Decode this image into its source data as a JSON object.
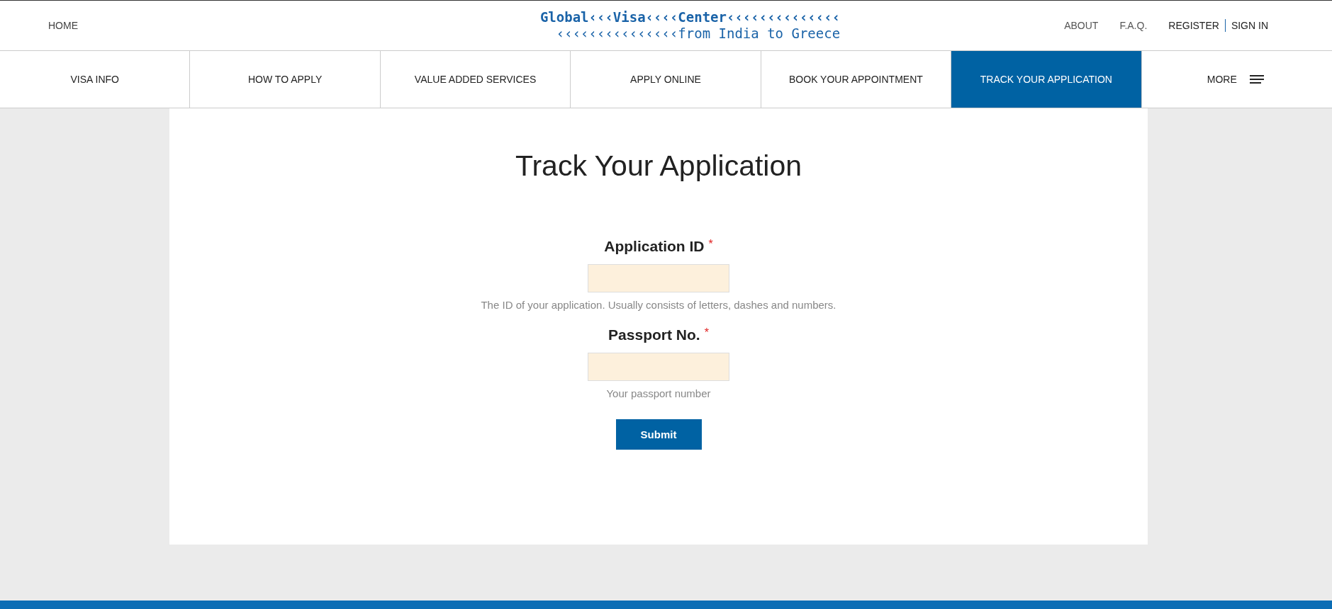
{
  "header": {
    "home": "HOME",
    "logo_line1": "Global‹‹‹Visa‹‹‹‹Center‹‹‹‹‹‹‹‹‹‹‹‹‹‹",
    "logo_line2": "‹‹‹‹‹‹‹‹‹‹‹‹‹‹‹from India to Greece",
    "links": [
      "ABOUT",
      "F.A.Q."
    ],
    "register": "REGISTER",
    "sign_in": "SIGN IN"
  },
  "nav": [
    {
      "label": "VISA INFO",
      "selected": false
    },
    {
      "label": "HOW TO APPLY",
      "selected": false
    },
    {
      "label": "VALUE ADDED SERVICES",
      "selected": false
    },
    {
      "label": "APPLY ONLINE",
      "selected": false
    },
    {
      "label": "BOOK YOUR APPOINTMENT",
      "selected": false
    },
    {
      "label": "TRACK YOUR APPLICATION",
      "selected": true
    },
    {
      "label": "MORE",
      "selected": false,
      "kind": "menu"
    }
  ],
  "page": {
    "title": "Track Your Application",
    "fields": [
      {
        "label": "Application ID",
        "required": "*",
        "hint": "The ID of your application. Usually consists of letters, dashes and numbers."
      },
      {
        "label": "Passport No.",
        "required": "*",
        "hint": "Your passport number"
      }
    ],
    "submit": "Submit"
  }
}
